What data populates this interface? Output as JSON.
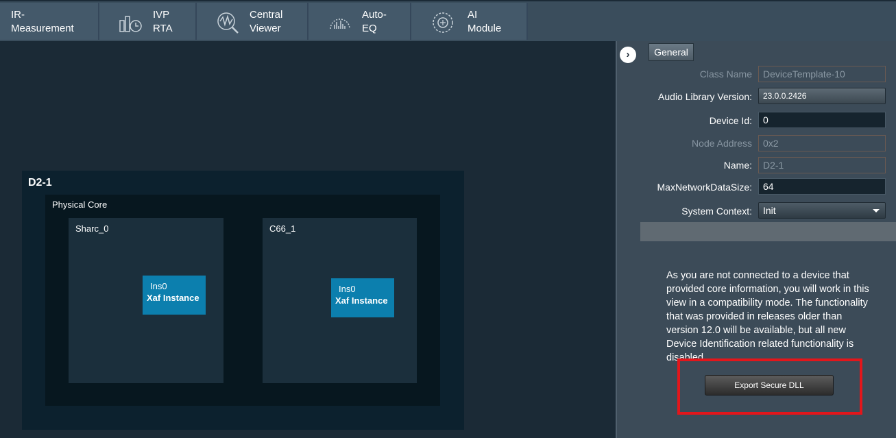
{
  "toolbar": {
    "items": [
      {
        "label": "IR-\nMeasurement",
        "icon": "ir-measurement-icon"
      },
      {
        "label": "IVP\nRTA",
        "icon": "ivp-rta-icon"
      },
      {
        "label": "Central\nViewer",
        "icon": "central-viewer-icon"
      },
      {
        "label": "Auto-\nEQ",
        "icon": "auto-eq-icon"
      },
      {
        "label": "AI\nModule",
        "icon": "ai-module-icon"
      }
    ]
  },
  "canvas": {
    "device_title": "D2-1",
    "physical_core_title": "Physical Core",
    "cores": [
      {
        "name": "Sharc_0",
        "instance": {
          "id": "Ins0",
          "name": "Xaf Instance"
        }
      },
      {
        "name": "C66_1",
        "instance": {
          "id": "Ins0",
          "name": "Xaf Instance"
        }
      }
    ]
  },
  "panel": {
    "tab_label": "General",
    "properties": {
      "class_name": {
        "label": "Class Name",
        "value": "DeviceTemplate-10"
      },
      "audio_library_version": {
        "label": "Audio Library Version:",
        "value": "23.0.0.2426"
      },
      "device_id": {
        "label": "Device Id:",
        "value": "0"
      },
      "node_address": {
        "label": "Node Address",
        "value": "0x2"
      },
      "name": {
        "label": "Name:",
        "value": "D2-1"
      },
      "max_network_data_size": {
        "label": "MaxNetworkDataSize:",
        "value": "64"
      },
      "system_context": {
        "label": "System Context:",
        "value": "Init"
      }
    },
    "info_text": "As you are not connected to a device that provided core information, you will work in this view in a compatibility mode. The functionality that was provided in releases older than version 12.0 will be available, but all new Device Identification related functionality is disabled.",
    "export_button": "Export Secure DLL"
  },
  "colors": {
    "accent_instance": "#0c7fae",
    "highlight": "#e3161b",
    "background": "#1b2a36"
  }
}
